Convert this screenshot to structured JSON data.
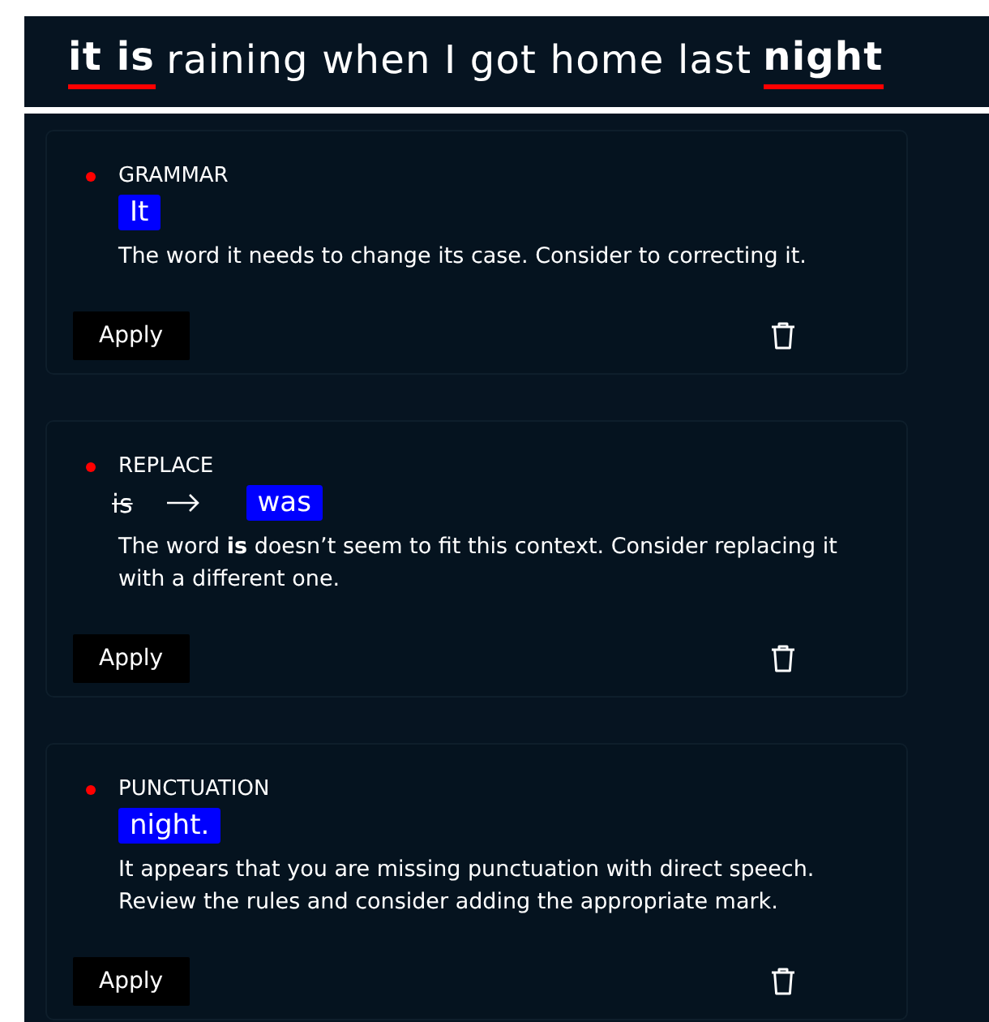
{
  "sentence": [
    {
      "text": "it is",
      "flagged": true
    },
    {
      "text": "raining when I got home last",
      "flagged": false
    },
    {
      "text": "night",
      "flagged": true
    }
  ],
  "suggestions": [
    {
      "category": "GRAMMAR",
      "color": "#ff0000",
      "kind": "highlight",
      "replacement": "It",
      "description": "The word it needs to change its case. Consider to correcting it.",
      "button": "Apply"
    },
    {
      "category": "REPLACE",
      "color": "#ff0000",
      "kind": "replace",
      "original": "is",
      "replacement": "was",
      "description": "The word **is** doesn’t seem to fit this context. Consider replacing it with a different one.",
      "button": "Apply"
    },
    {
      "category": "PUNCTUATION",
      "color": "#ff0000",
      "kind": "highlight",
      "replacement": "night.",
      "description": "It appears that you are missing punctuation with direct speech. Review the rules and consider adding the appropriate mark.",
      "button": "Apply"
    }
  ]
}
